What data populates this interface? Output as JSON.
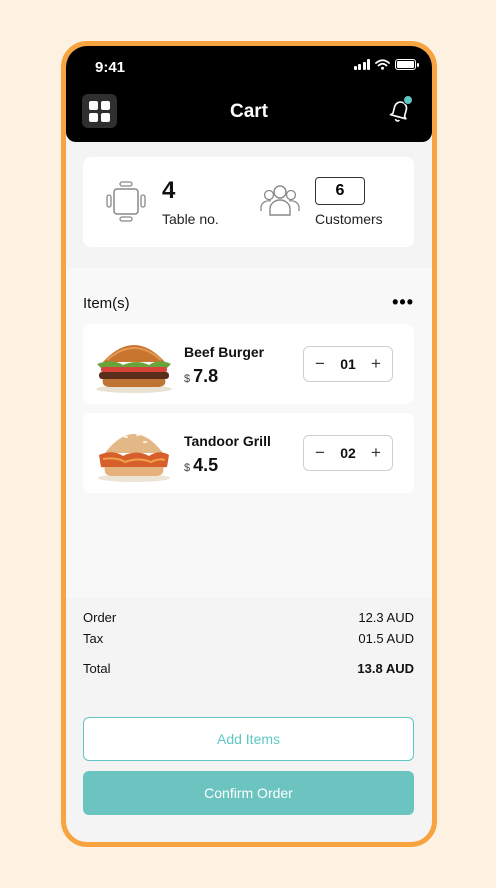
{
  "status_bar": {
    "time": "9:41"
  },
  "header": {
    "title": "Cart"
  },
  "table_info": {
    "table_number": "4",
    "table_label": "Table no.",
    "customers_count": "6",
    "customers_label": "Customers"
  },
  "items_section": {
    "title": "Item(s)",
    "more": "•••",
    "items": [
      {
        "name": "Beef Burger",
        "currency": "$",
        "price": "7.8",
        "qty": "01",
        "minus": "−",
        "plus": "+"
      },
      {
        "name": "Tandoor Grill",
        "currency": "$",
        "price": "4.5",
        "qty": "02",
        "minus": "−",
        "plus": "+"
      }
    ]
  },
  "summary": {
    "order_label": "Order",
    "order_value": "12.3 AUD",
    "tax_label": "Tax",
    "tax_value": "01.5 AUD",
    "total_label": "Total",
    "total_value": "13.8 AUD"
  },
  "actions": {
    "add_items": "Add Items",
    "confirm_order": "Confirm Order"
  },
  "colors": {
    "accent": "#6cc4c1",
    "frame": "#f7a440",
    "background": "#fdf1e2"
  }
}
